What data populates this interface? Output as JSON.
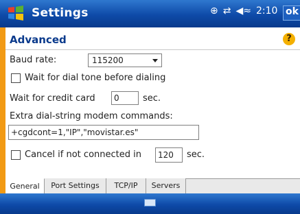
{
  "titlebar": {
    "title": "Settings",
    "clock": "2:10",
    "ok_label": "ok",
    "status_icons": [
      "connectivity-icon",
      "signal-icon",
      "speaker-icon"
    ]
  },
  "page": {
    "heading": "Advanced"
  },
  "form": {
    "baud_rate_label": "Baud rate:",
    "baud_rate_value": "115200",
    "wait_dial_tone_label": "Wait for dial tone before dialing",
    "wait_dial_tone_checked": false,
    "wait_credit_card_label": "Wait for credit card",
    "wait_credit_card_value": "0",
    "sec_label_1": "sec.",
    "extra_dial_label": "Extra dial-string modem commands:",
    "extra_dial_value": "+cgdcont=1,\"IP\",\"movistar.es\"",
    "cancel_label": "Cancel if not connected in",
    "cancel_value": "120",
    "cancel_checked": false,
    "sec_label_2": "sec."
  },
  "tabs": [
    {
      "label": "General",
      "active": true
    },
    {
      "label": "Port Settings",
      "active": false
    },
    {
      "label": "TCP/IP",
      "active": false
    },
    {
      "label": "Servers",
      "active": false
    }
  ],
  "colors": {
    "titlebar": "#0e4aa8",
    "frame": "#f29a14",
    "heading": "#0a3a8c"
  }
}
